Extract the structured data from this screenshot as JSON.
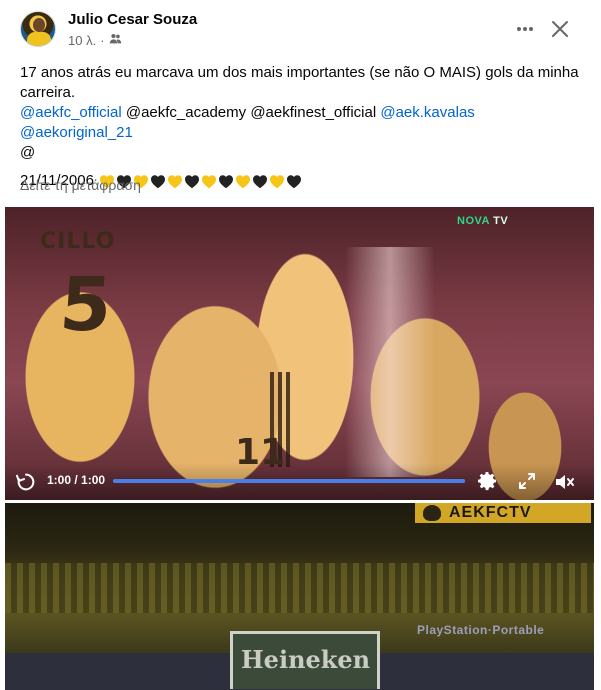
{
  "post": {
    "author": "Julio Cesar Souza",
    "time": "10 λ.",
    "meta_sep": "·",
    "text_line1": "17 anos atrás eu marcava um dos mais importantes (se não O MAIS) gols da minha carreira.",
    "mentions": [
      {
        "text": "@aekfc_official",
        "linked": true
      },
      {
        "text": "@aekfc_academy",
        "linked": false
      },
      {
        "text": "@aekfinest_official",
        "linked": false
      },
      {
        "text": "@aek.kavalas",
        "linked": true
      },
      {
        "text": "@aekoriginal_21",
        "linked": true
      }
    ],
    "at_line": "@",
    "date": "21/11/2006",
    "hearts": [
      "yellow",
      "black",
      "yellow",
      "black",
      "yellow",
      "black",
      "yellow",
      "black",
      "yellow",
      "black",
      "yellow",
      "black"
    ],
    "see_translation": "Δείτε τη μετάφραση"
  },
  "video1": {
    "time": "1:00 / 1:00",
    "progress": 1.0,
    "channel_logo_prefix": "NOVA",
    "channel_logo_suffix": "TV",
    "jersey_name": "CILLO",
    "jersey_number": "5",
    "jersey_number_2": "11"
  },
  "video2": {
    "logo": "AEKFCTV",
    "board_text": "Heineken",
    "side_board": "PlayStation·Portable"
  },
  "colors": {
    "link": "#0064d1",
    "secondary_text": "#65676b",
    "progress": "#4a7fe8",
    "heart_yellow": "#f5c518",
    "heart_black": "#222222"
  },
  "icons": {
    "audience": "friends-icon",
    "more": "more-dots-icon",
    "close": "close-icon",
    "replay": "replay-icon",
    "settings": "gear-icon",
    "fullscreen": "fullscreen-icon",
    "mute": "volume-muted-icon"
  }
}
